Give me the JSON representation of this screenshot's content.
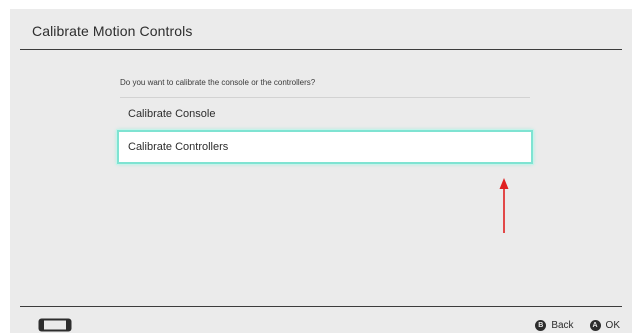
{
  "header": {
    "title": "Calibrate Motion Controls"
  },
  "main": {
    "prompt": "Do you want to calibrate the console or the controllers?",
    "options": [
      {
        "label": "Calibrate Console",
        "selected": false
      },
      {
        "label": "Calibrate Controllers",
        "selected": true
      }
    ]
  },
  "annotation": {
    "arrow_color": "#e02020"
  },
  "footer": {
    "device_icon": "console-handheld-icon",
    "buttons": [
      {
        "glyph": "B",
        "label": "Back",
        "icon": "b-button-icon"
      },
      {
        "glyph": "A",
        "label": "OK",
        "icon": "a-button-icon"
      }
    ]
  },
  "colors": {
    "background": "#ebebeb",
    "selection_border": "#7fe3d2",
    "text": "#2d2d2d"
  }
}
